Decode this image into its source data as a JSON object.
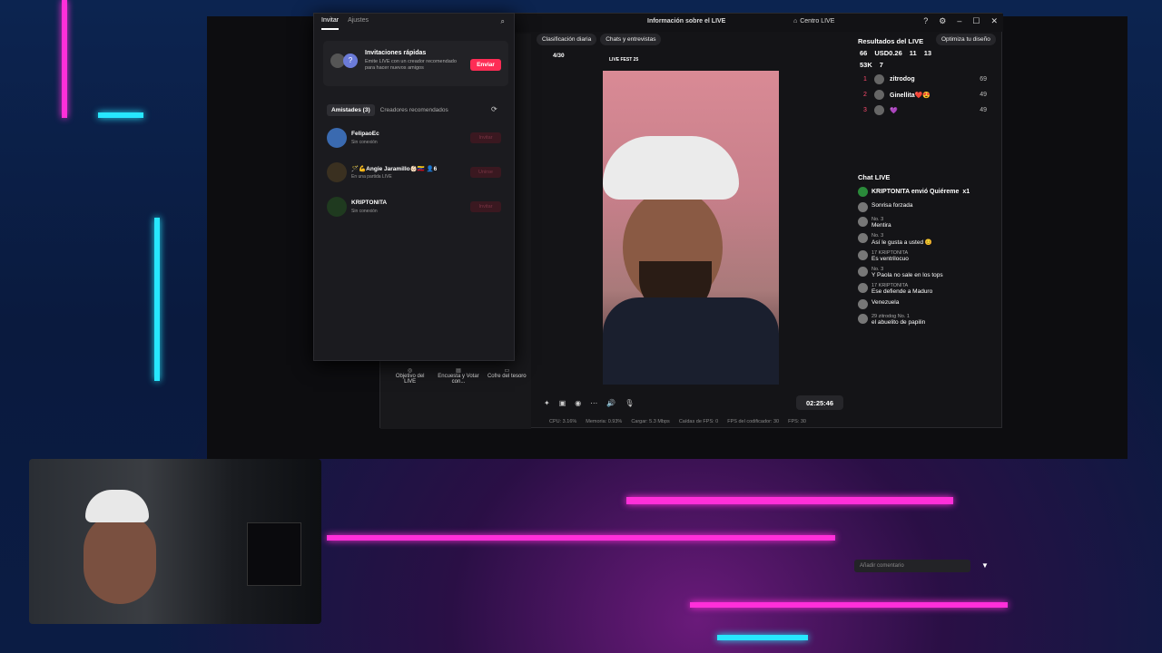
{
  "invite_panel": {
    "tabs": [
      "Invitar",
      "Ajustes"
    ],
    "quick_invite": {
      "title": "Invitaciones rápidas",
      "desc": "Emite LIVE con un creador recomendado para hacer nuevos amigos",
      "button": "Enviar"
    },
    "friend_tabs": [
      "Amistades (3)",
      "Creadores recomendados"
    ],
    "friends": [
      {
        "name": "FelipaoEc",
        "status": "Sin conexión",
        "button": "Invitar"
      },
      {
        "name": "🪄💪Angie Jaramillo👶🏻🇻🇪  👤6",
        "status": "En una partida LIVE",
        "button": "Unirse"
      },
      {
        "name": "KRIPTONITA",
        "status": "Sin conexión",
        "button": "Invitar"
      }
    ]
  },
  "app": {
    "title": "Información sobre el LIVE",
    "centro": "Centro LIVE",
    "pills": [
      "Clasificación diaria",
      "Chats y entrevistas"
    ],
    "optimize": "Optimiza tu diseño",
    "goal": "4/30",
    "fest": "LIVE FEST 25",
    "tools": [
      "Objetivo del LIVE",
      "Encuesta y Votar con...",
      "Cofre del tesoro"
    ],
    "timer": "02:25:46",
    "stats": [
      "CPU: 3.16%",
      "Memoria: 0.93%",
      "Cargar: 5.3 Mbps",
      "Caídas de FPS: 0",
      "FPS del codificador: 30",
      "FPS: 30"
    ]
  },
  "results": {
    "title": "Resultados del LIVE",
    "kpis": [
      "66",
      "USD0.26",
      "11",
      "13",
      "53K",
      "7"
    ],
    "ranking": [
      {
        "n": "1",
        "name": "zitrodog",
        "score": "69"
      },
      {
        "n": "2",
        "name": "Ginellita❤️😍",
        "score": "49"
      },
      {
        "n": "3",
        "name": "💜",
        "score": "49"
      }
    ]
  },
  "chat": {
    "title": "Chat LIVE",
    "gift": "KRIPTONITA envió Quiéreme",
    "gift_count": "x1",
    "messages": [
      {
        "meta": "",
        "text": "Sonrisa forzada"
      },
      {
        "meta": "No. 3",
        "text": "Mentira"
      },
      {
        "meta": "No. 3",
        "text": "Así le gusta a usted 😊"
      },
      {
        "meta": "17 KRIPTONITA",
        "text": "Es ventrilocuo"
      },
      {
        "meta": "No. 3",
        "text": "Y Paola no sale en los tops"
      },
      {
        "meta": "17 KRIPTONITA",
        "text": "Ese defiende a Maduro"
      },
      {
        "meta": "",
        "text": "Venezuela"
      },
      {
        "meta": "29 zitrodog No. 1",
        "text": "el abuelito de papilin"
      }
    ],
    "placeholder": "Añadir comentario"
  }
}
